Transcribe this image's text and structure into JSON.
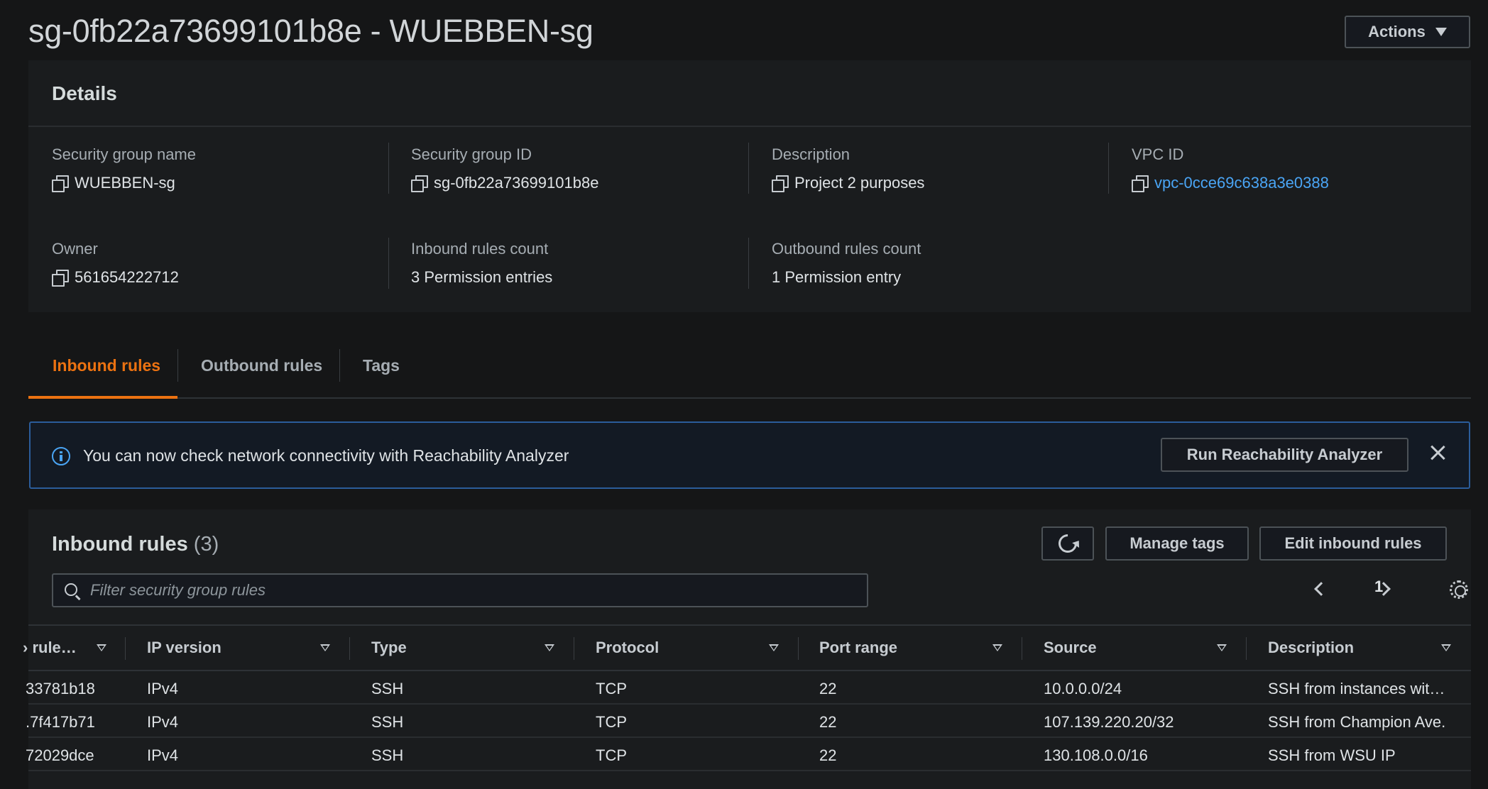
{
  "header": {
    "title": "sg-0fb22a73699101b8e - WUEBBEN-sg",
    "actions_label": "Actions"
  },
  "details": {
    "title": "Details",
    "fields": [
      {
        "label": "Security group name",
        "value": "WUEBBEN-sg"
      },
      {
        "label": "Security group ID",
        "value": "sg-0fb22a73699101b8e"
      },
      {
        "label": "Description",
        "value": "Project 2 purposes"
      },
      {
        "label": "VPC ID",
        "value": "vpc-0cce69c638a3e0388"
      },
      {
        "label": "Owner",
        "value": "561654222712"
      },
      {
        "label": "Inbound rules count",
        "value": "3 Permission entries"
      },
      {
        "label": "Outbound rules count",
        "value": "1 Permission entry"
      }
    ]
  },
  "tabs": [
    {
      "label": "Inbound rules",
      "active": true
    },
    {
      "label": "Outbound rules",
      "active": false
    },
    {
      "label": "Tags",
      "active": false
    }
  ],
  "alert": {
    "text": "You can now check network connectivity with Reachability Analyzer",
    "button_label": "Run Reachability Analyzer"
  },
  "rules": {
    "title": "Inbound rules",
    "count": "(3)",
    "manage_tags_label": "Manage tags",
    "edit_label": "Edit inbound rules",
    "search_placeholder": "Filter security group rules",
    "page": "1",
    "columns": [
      "› rule…",
      "IP version",
      "Type",
      "Protocol",
      "Port range",
      "Source",
      "Description"
    ],
    "rows": [
      [
        "33781b18",
        "IPv4",
        "SSH",
        "TCP",
        "22",
        "10.0.0.0/24",
        "SSH from instances wit…"
      ],
      [
        ".7f417b71",
        "IPv4",
        "SSH",
        "TCP",
        "22",
        "107.139.220.20/32",
        "SSH from Champion Ave."
      ],
      [
        "72029dce",
        "IPv4",
        "SSH",
        "TCP",
        "22",
        "130.108.0.0/16",
        "SSH from WSU IP"
      ]
    ]
  },
  "colors": {
    "accent": "#ec7211",
    "link": "#4aa5f5",
    "background": "#151617"
  }
}
